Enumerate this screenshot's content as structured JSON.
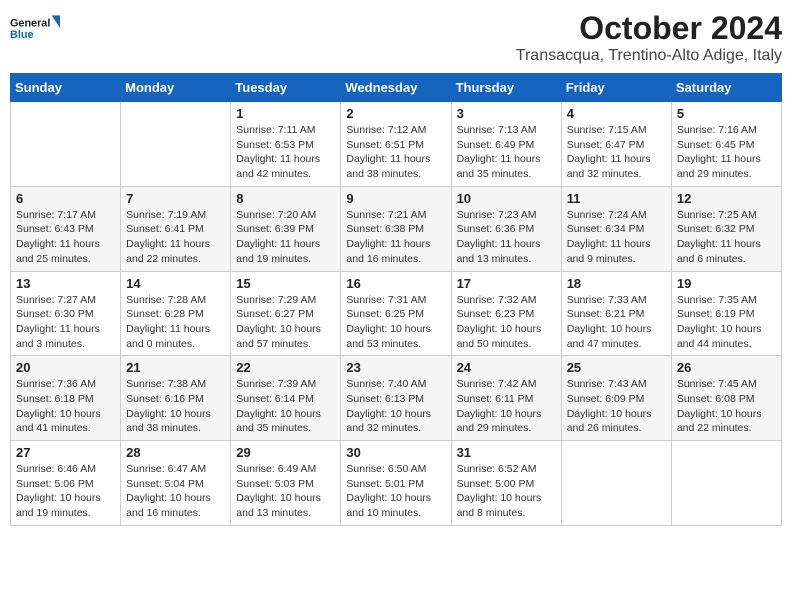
{
  "header": {
    "logo_general": "General",
    "logo_blue": "Blue",
    "month_title": "October 2024",
    "subtitle": "Transacqua, Trentino-Alto Adige, Italy"
  },
  "days_of_week": [
    "Sunday",
    "Monday",
    "Tuesday",
    "Wednesday",
    "Thursday",
    "Friday",
    "Saturday"
  ],
  "weeks": [
    [
      {
        "day": "",
        "sunrise": "",
        "sunset": "",
        "daylight": ""
      },
      {
        "day": "",
        "sunrise": "",
        "sunset": "",
        "daylight": ""
      },
      {
        "day": "1",
        "sunrise": "Sunrise: 7:11 AM",
        "sunset": "Sunset: 6:53 PM",
        "daylight": "Daylight: 11 hours and 42 minutes."
      },
      {
        "day": "2",
        "sunrise": "Sunrise: 7:12 AM",
        "sunset": "Sunset: 6:51 PM",
        "daylight": "Daylight: 11 hours and 38 minutes."
      },
      {
        "day": "3",
        "sunrise": "Sunrise: 7:13 AM",
        "sunset": "Sunset: 6:49 PM",
        "daylight": "Daylight: 11 hours and 35 minutes."
      },
      {
        "day": "4",
        "sunrise": "Sunrise: 7:15 AM",
        "sunset": "Sunset: 6:47 PM",
        "daylight": "Daylight: 11 hours and 32 minutes."
      },
      {
        "day": "5",
        "sunrise": "Sunrise: 7:16 AM",
        "sunset": "Sunset: 6:45 PM",
        "daylight": "Daylight: 11 hours and 29 minutes."
      }
    ],
    [
      {
        "day": "6",
        "sunrise": "Sunrise: 7:17 AM",
        "sunset": "Sunset: 6:43 PM",
        "daylight": "Daylight: 11 hours and 25 minutes."
      },
      {
        "day": "7",
        "sunrise": "Sunrise: 7:19 AM",
        "sunset": "Sunset: 6:41 PM",
        "daylight": "Daylight: 11 hours and 22 minutes."
      },
      {
        "day": "8",
        "sunrise": "Sunrise: 7:20 AM",
        "sunset": "Sunset: 6:39 PM",
        "daylight": "Daylight: 11 hours and 19 minutes."
      },
      {
        "day": "9",
        "sunrise": "Sunrise: 7:21 AM",
        "sunset": "Sunset: 6:38 PM",
        "daylight": "Daylight: 11 hours and 16 minutes."
      },
      {
        "day": "10",
        "sunrise": "Sunrise: 7:23 AM",
        "sunset": "Sunset: 6:36 PM",
        "daylight": "Daylight: 11 hours and 13 minutes."
      },
      {
        "day": "11",
        "sunrise": "Sunrise: 7:24 AM",
        "sunset": "Sunset: 6:34 PM",
        "daylight": "Daylight: 11 hours and 9 minutes."
      },
      {
        "day": "12",
        "sunrise": "Sunrise: 7:25 AM",
        "sunset": "Sunset: 6:32 PM",
        "daylight": "Daylight: 11 hours and 6 minutes."
      }
    ],
    [
      {
        "day": "13",
        "sunrise": "Sunrise: 7:27 AM",
        "sunset": "Sunset: 6:30 PM",
        "daylight": "Daylight: 11 hours and 3 minutes."
      },
      {
        "day": "14",
        "sunrise": "Sunrise: 7:28 AM",
        "sunset": "Sunset: 6:28 PM",
        "daylight": "Daylight: 11 hours and 0 minutes."
      },
      {
        "day": "15",
        "sunrise": "Sunrise: 7:29 AM",
        "sunset": "Sunset: 6:27 PM",
        "daylight": "Daylight: 10 hours and 57 minutes."
      },
      {
        "day": "16",
        "sunrise": "Sunrise: 7:31 AM",
        "sunset": "Sunset: 6:25 PM",
        "daylight": "Daylight: 10 hours and 53 minutes."
      },
      {
        "day": "17",
        "sunrise": "Sunrise: 7:32 AM",
        "sunset": "Sunset: 6:23 PM",
        "daylight": "Daylight: 10 hours and 50 minutes."
      },
      {
        "day": "18",
        "sunrise": "Sunrise: 7:33 AM",
        "sunset": "Sunset: 6:21 PM",
        "daylight": "Daylight: 10 hours and 47 minutes."
      },
      {
        "day": "19",
        "sunrise": "Sunrise: 7:35 AM",
        "sunset": "Sunset: 6:19 PM",
        "daylight": "Daylight: 10 hours and 44 minutes."
      }
    ],
    [
      {
        "day": "20",
        "sunrise": "Sunrise: 7:36 AM",
        "sunset": "Sunset: 6:18 PM",
        "daylight": "Daylight: 10 hours and 41 minutes."
      },
      {
        "day": "21",
        "sunrise": "Sunrise: 7:38 AM",
        "sunset": "Sunset: 6:16 PM",
        "daylight": "Daylight: 10 hours and 38 minutes."
      },
      {
        "day": "22",
        "sunrise": "Sunrise: 7:39 AM",
        "sunset": "Sunset: 6:14 PM",
        "daylight": "Daylight: 10 hours and 35 minutes."
      },
      {
        "day": "23",
        "sunrise": "Sunrise: 7:40 AM",
        "sunset": "Sunset: 6:13 PM",
        "daylight": "Daylight: 10 hours and 32 minutes."
      },
      {
        "day": "24",
        "sunrise": "Sunrise: 7:42 AM",
        "sunset": "Sunset: 6:11 PM",
        "daylight": "Daylight: 10 hours and 29 minutes."
      },
      {
        "day": "25",
        "sunrise": "Sunrise: 7:43 AM",
        "sunset": "Sunset: 6:09 PM",
        "daylight": "Daylight: 10 hours and 26 minutes."
      },
      {
        "day": "26",
        "sunrise": "Sunrise: 7:45 AM",
        "sunset": "Sunset: 6:08 PM",
        "daylight": "Daylight: 10 hours and 22 minutes."
      }
    ],
    [
      {
        "day": "27",
        "sunrise": "Sunrise: 6:46 AM",
        "sunset": "Sunset: 5:06 PM",
        "daylight": "Daylight: 10 hours and 19 minutes."
      },
      {
        "day": "28",
        "sunrise": "Sunrise: 6:47 AM",
        "sunset": "Sunset: 5:04 PM",
        "daylight": "Daylight: 10 hours and 16 minutes."
      },
      {
        "day": "29",
        "sunrise": "Sunrise: 6:49 AM",
        "sunset": "Sunset: 5:03 PM",
        "daylight": "Daylight: 10 hours and 13 minutes."
      },
      {
        "day": "30",
        "sunrise": "Sunrise: 6:50 AM",
        "sunset": "Sunset: 5:01 PM",
        "daylight": "Daylight: 10 hours and 10 minutes."
      },
      {
        "day": "31",
        "sunrise": "Sunrise: 6:52 AM",
        "sunset": "Sunset: 5:00 PM",
        "daylight": "Daylight: 10 hours and 8 minutes."
      },
      {
        "day": "",
        "sunrise": "",
        "sunset": "",
        "daylight": ""
      },
      {
        "day": "",
        "sunrise": "",
        "sunset": "",
        "daylight": ""
      }
    ]
  ]
}
